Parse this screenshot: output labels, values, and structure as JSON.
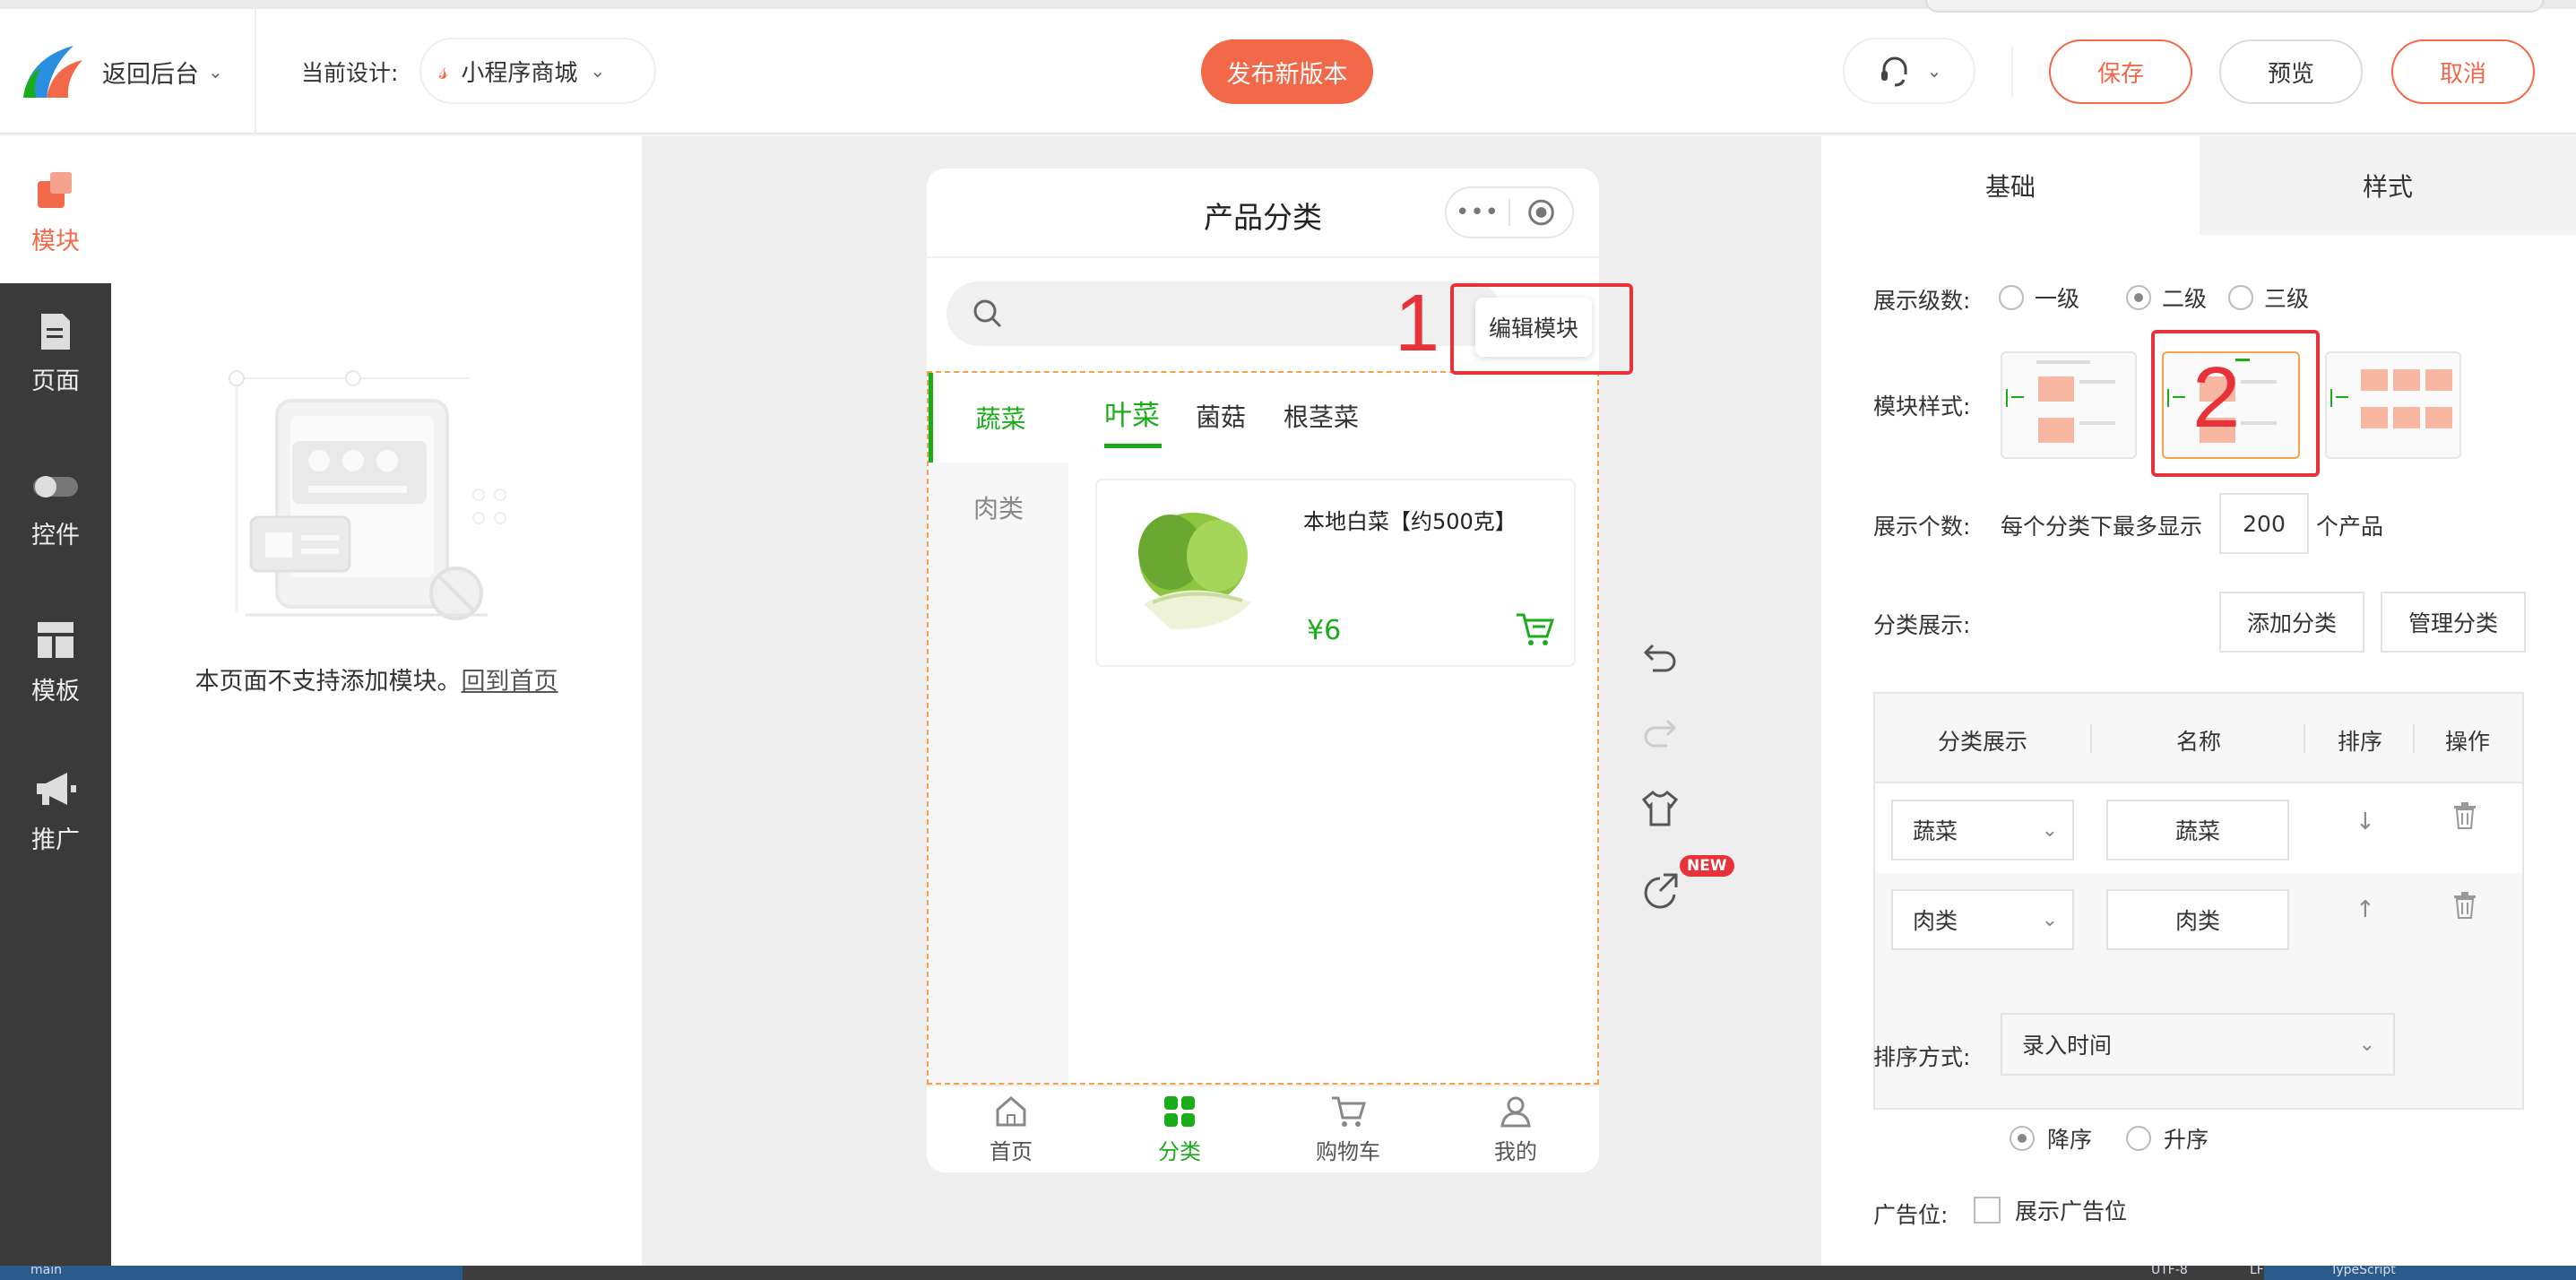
{
  "topbar": {
    "back_label": "返回后台",
    "current_design_label": "当前设计:",
    "design_name": "小程序商城",
    "publish_label": "发布新版本",
    "save_label": "保存",
    "preview_label": "预览",
    "cancel_label": "取消"
  },
  "rail": {
    "items": [
      {
        "label": "模块",
        "icon": "module-icon"
      },
      {
        "label": "页面",
        "icon": "page-icon"
      },
      {
        "label": "控件",
        "icon": "toggle-icon"
      },
      {
        "label": "模板",
        "icon": "template-icon"
      },
      {
        "label": "推广",
        "icon": "megaphone-icon"
      }
    ]
  },
  "empty_panel": {
    "message": "本页面不支持添加模块。",
    "link": "回到首页"
  },
  "phone": {
    "title": "产品分类",
    "edit_module_label": "编辑模块",
    "annotation_1": "1",
    "left_categories": [
      "蔬菜",
      "肉类"
    ],
    "sub_tabs": [
      "叶菜",
      "菌菇",
      "根茎菜"
    ],
    "product": {
      "name": "本地白菜【约500克】",
      "price": "¥6"
    },
    "bottom_nav": [
      "首页",
      "分类",
      "购物车",
      "我的"
    ],
    "new_badge": "NEW"
  },
  "settings": {
    "tabs": [
      "基础",
      "样式"
    ],
    "display_level_label": "展示级数:",
    "levels": [
      "一级",
      "二级",
      "三级"
    ],
    "module_style_label": "模块样式:",
    "annotation_2": "2",
    "display_count_label": "展示个数:",
    "count_prefix": "每个分类下最多显示",
    "count_value": "200",
    "count_suffix": "个产品",
    "category_display_label": "分类展示:",
    "add_category": "添加分类",
    "manage_category": "管理分类",
    "table_headers": [
      "分类展示",
      "名称",
      "排序",
      "操作"
    ],
    "table_rows": [
      {
        "select": "蔬菜",
        "name": "蔬菜"
      },
      {
        "select": "肉类",
        "name": "肉类"
      }
    ],
    "sort_label": "排序方式:",
    "sort_value": "录入时间",
    "order_desc": "降序",
    "order_asc": "升序",
    "ad_label": "广告位:",
    "ad_checkbox": "展示广告位"
  },
  "statusbar": {
    "branch": "main",
    "encoding": "UTF-8",
    "eol": "LF",
    "language": "TypeScript"
  },
  "colors": {
    "accent": "#f2694a",
    "green": "#1aad19",
    "rail": "#3a3a3a",
    "annotation": "#e8323a"
  }
}
